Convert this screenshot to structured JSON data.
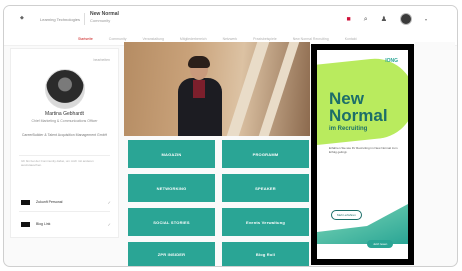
{
  "header": {
    "menu_label": "Learning Technologies",
    "brand_title": "New Normal",
    "brand_subtitle": "Community"
  },
  "nav": {
    "items": [
      "Startseite",
      "Community",
      "Veranstaltung",
      "Mitgliederbereich",
      "Netzwerk",
      "Praxisbeispiele",
      "New Normal Recruiting",
      "Kontakt"
    ]
  },
  "profile": {
    "edit_label": "bearbeiten",
    "name": "Martina Gebhardt",
    "role": "Chief Marketing & Communications Officer",
    "company": "CareerBuilder & Talent Acquisition Management GmbH",
    "description": "Ich bin bei der Community dabei, um mich mit anderen auszutauschen.",
    "social": [
      {
        "label": "Zukunft Personal",
        "check": "✓"
      },
      {
        "label": "Blog Link",
        "check": "✓"
      }
    ]
  },
  "tiles": [
    {
      "label": "MAGAZIN"
    },
    {
      "label": "PROGRAMM"
    },
    {
      "label": "NETWORKING"
    },
    {
      "label": "SPEAKER"
    },
    {
      "label": "SOCIAL STORIES"
    },
    {
      "label": "Events Verwaltung"
    },
    {
      "label": "ZPR INSIDER"
    },
    {
      "label": "Blog Roll"
    }
  ],
  "ad": {
    "logo": "IONG",
    "headline": "New Normal",
    "subheadline": "im Recruiting",
    "copy": "Erfahren Sie wie Ihr Recruiting im New Normal zum Erfolg gelingt.",
    "secondary_button": "Mehr erfahren",
    "primary_button": "Jetzt lesen"
  },
  "colors": {
    "accent": "#2aa595",
    "ad_green": "#b9eb5e",
    "ad_text": "#1c6e69",
    "highlight": "#000000",
    "alert": "#d0103a"
  },
  "icons": [
    "logo-icon",
    "bell-icon",
    "search-icon",
    "user-icon",
    "avatar"
  ]
}
